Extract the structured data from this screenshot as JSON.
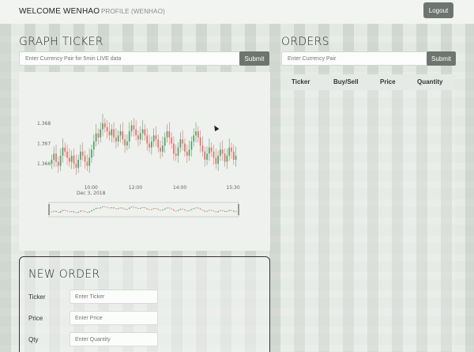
{
  "nav": {
    "brand": "WELCOME WENHAO",
    "profile_link": "PROFILE (WENHAO)",
    "logout_label": "Logout"
  },
  "graph_ticker": {
    "title": "GRAPH TICKER",
    "input_placeholder": "Enter Currency Pair for 5min LIVE data",
    "submit_label": "Submit"
  },
  "orders": {
    "title": "ORDERS",
    "input_placeholder": "Enter Currency Pair",
    "submit_label": "Submit",
    "columns": [
      "Ticker",
      "Buy/Sell",
      "Price",
      "Quantity"
    ]
  },
  "new_order": {
    "title": "NEW ORDER",
    "fields": [
      {
        "label": "Ticker",
        "placeholder": "Enter Ticker"
      },
      {
        "label": "Price",
        "placeholder": "Enter Price"
      },
      {
        "label": "Qty",
        "placeholder": "Enter Quantity"
      }
    ]
  },
  "colors": {
    "up_candle": "#5aa06a",
    "down_candle": "#e0756a",
    "button": "#6e7570"
  },
  "chart_data": {
    "type": "candlestick",
    "x_tick_labels": [
      "10:00",
      "12:00",
      "14:00",
      "15:30"
    ],
    "x_date_label": "Dec 3, 2018",
    "y_tick_labels": [
      "1.368",
      "1.367",
      "1.366"
    ],
    "y_ticks": [
      1.368,
      1.367,
      1.366
    ],
    "ylim": [
      1.3653,
      1.3685
    ],
    "xlim": [
      0,
      84
    ],
    "x_tick_positions": [
      18,
      38,
      58,
      82
    ],
    "close": [
      1.3662,
      1.3665,
      1.3661,
      1.3659,
      1.3664,
      1.3668,
      1.3666,
      1.3663,
      1.3661,
      1.3664,
      1.366,
      1.3658,
      1.3662,
      1.3666,
      1.3664,
      1.3661,
      1.3659,
      1.3663,
      1.3667,
      1.3671,
      1.3675,
      1.3673,
      1.3677,
      1.368,
      1.3678,
      1.3676,
      1.3674,
      1.3677,
      1.3673,
      1.3671,
      1.3674,
      1.3676,
      1.3672,
      1.3669,
      1.3671,
      1.3676,
      1.3679,
      1.3677,
      1.3674,
      1.3672,
      1.3675,
      1.3677,
      1.3674,
      1.367,
      1.3668,
      1.3671,
      1.3674,
      1.3672,
      1.3668,
      1.3666,
      1.3669,
      1.3673,
      1.3676,
      1.3673,
      1.367,
      1.3665,
      1.3664,
      1.3668,
      1.3672,
      1.367,
      1.3666,
      1.3664,
      1.3667,
      1.3671,
      1.3674,
      1.3676,
      1.3673,
      1.3669,
      1.3666,
      1.3662,
      1.3665,
      1.3668,
      1.3666,
      1.3663,
      1.366,
      1.3664,
      1.3667,
      1.3665,
      1.3661,
      1.3664,
      1.3668,
      1.3666,
      1.3662,
      1.3664
    ],
    "open_start": 1.366,
    "navigator_range": [
      0,
      84
    ]
  }
}
